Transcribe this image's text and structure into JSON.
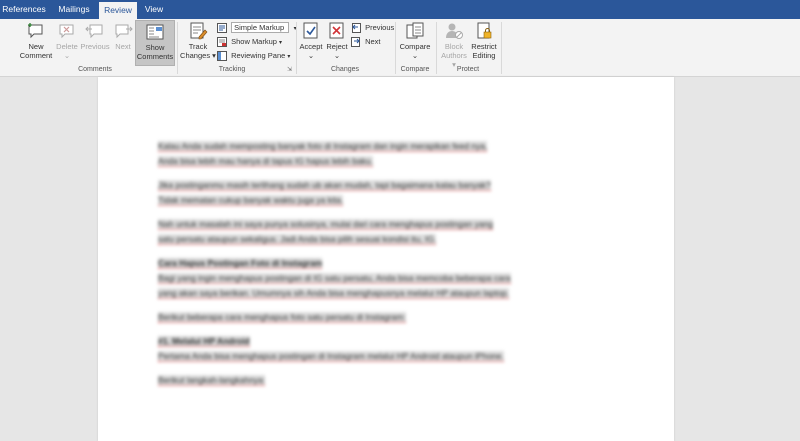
{
  "tabs": [
    "References",
    "Mailings",
    "Review",
    "View"
  ],
  "active_tab": "Review",
  "ribbon": {
    "comments": {
      "new_comment_1": "New",
      "new_comment_2": "Comment",
      "delete": "Delete",
      "previous": "Previous",
      "next": "Next",
      "show_comments_1": "Show",
      "show_comments_2": "Comments",
      "group_label": "Comments"
    },
    "tracking": {
      "track_changes_1": "Track",
      "track_changes_2": "Changes",
      "markup_select": "Simple Markup",
      "show_markup": "Show Markup",
      "reviewing_pane": "Reviewing Pane",
      "group_label": "Tracking"
    },
    "changes": {
      "accept": "Accept",
      "reject": "Reject",
      "previous": "Previous",
      "next": "Next",
      "group_label": "Changes"
    },
    "compare": {
      "compare": "Compare",
      "group_label": "Compare"
    },
    "protect": {
      "block_authors_1": "Block",
      "block_authors_2": "Authors",
      "restrict_editing_1": "Restrict",
      "restrict_editing_2": "Editing",
      "group_label": "Protect"
    }
  },
  "document": {
    "paragraphs": [
      "Kalau Anda sudah memposting banyak foto di Instagram dan ingin merapikan feed nya,",
      "Anda bisa lebih mau hanya di tapus IG hapus lebih baku.",
      "Jika postinganmu masih terlihang sudah ub akan mudah, tapi bagaimana kalau banyak?",
      "Tidak mematan cukup banyak waktu juga ya kita.",
      "Nah untuk masalah ini saya punya solusinya, mulai dari cara menghapus postingan yang",
      "satu persatu ataupun sekaligus. Jadi Anda bisa pilih sesuai kondisi itu, IG.",
      "Cara Hapus Postingan Foto di Instagram",
      "Bagi yang ingin menghapus postingan di IG satu persatu, Anda bisa memcoba beberapa cara",
      "yang akan saya berikan. Umumnya sih Anda bisa menghapusnya melalui HP ataupun laptop.",
      "Berikut beberapa cara menghapus foto satu persatu di Instagram:",
      "#1. Melalui HP Android",
      "Pertama Anda bisa menghapus postingan di Instagram melalui HP Android ataupun iPhone.",
      "Berikut langkah-langkahnya:"
    ]
  }
}
